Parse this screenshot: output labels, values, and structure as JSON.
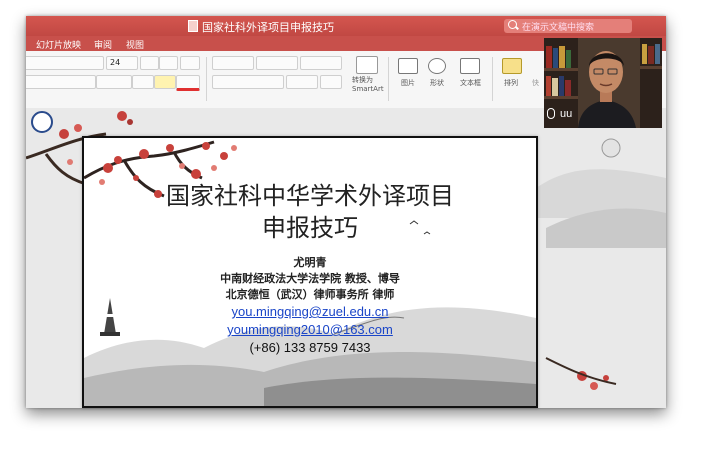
{
  "window": {
    "title": "国家社科外译项目申报技巧",
    "search_placeholder": "在演示文稿中搜索"
  },
  "ribbon_tabs": [
    "幻灯片放映",
    "审阅",
    "视图"
  ],
  "ribbon": {
    "font_size": "24",
    "convert_smartart": "转换为\nSmartArt",
    "picture_label": "图片",
    "shape_label": "形状",
    "textbox_label": "文本框",
    "arrange_label": "排列",
    "quick_label": "快"
  },
  "slide": {
    "title_line1": "国家社科中华学术外译项目",
    "title_line2": "申报技巧",
    "presenter": "尤明青",
    "affiliation1": "中南财经政法大学法学院 教授、博导",
    "affiliation2": "北京德恒（武汉）律师事务所 律师",
    "email1": "you.mingqing@zuel.edu.cn",
    "email2": "youmingqing2010@163.com",
    "phone": "(+86) 133 8759 7433"
  },
  "video": {
    "participant_name": "uu"
  },
  "colors": {
    "titlebar": "#c0504d",
    "link": "#1a45c8"
  }
}
